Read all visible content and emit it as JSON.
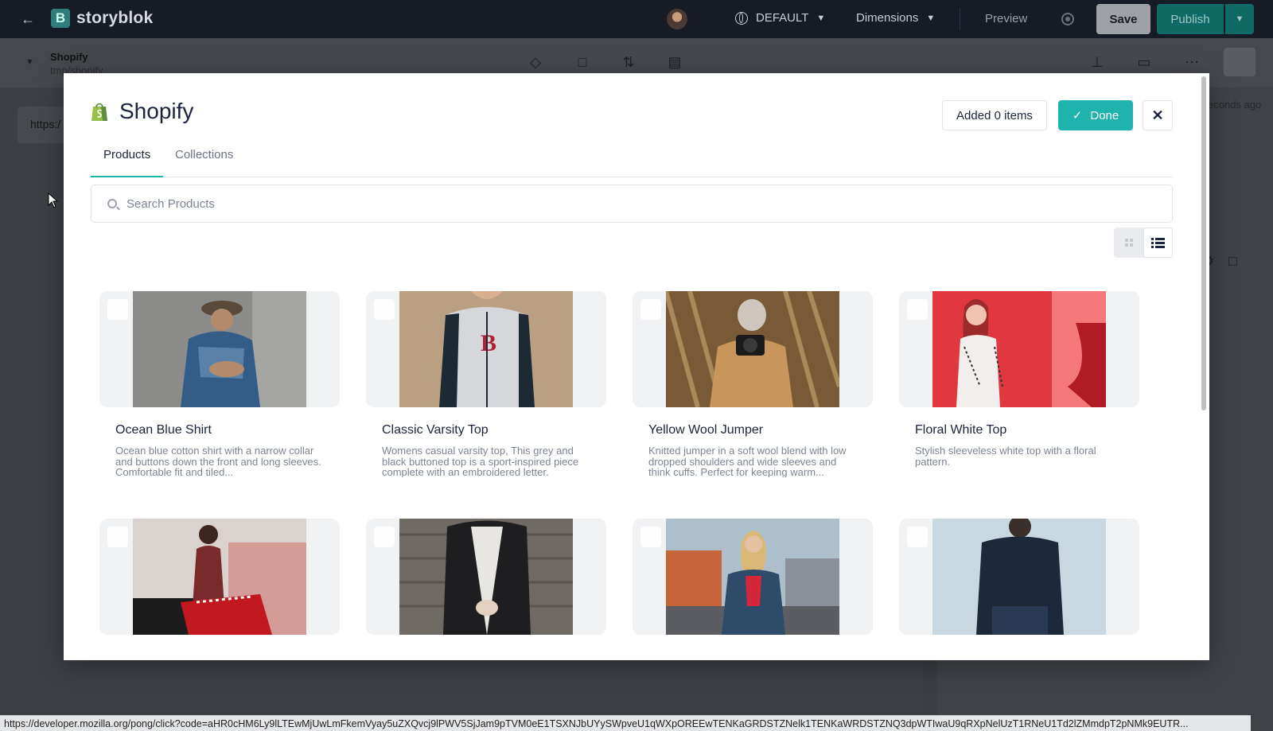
{
  "topbar": {
    "logo_text": "storyblok",
    "language": "DEFAULT",
    "dimensions": "Dimensions",
    "preview": "Preview",
    "save": "Save",
    "publish": "Publish"
  },
  "subbar": {
    "story_title": "Shopify",
    "story_path": "tmp/shopify"
  },
  "background": {
    "url_field": "https:/",
    "saved_time": "econds ago"
  },
  "modal": {
    "title": "Shopify",
    "added_label": "Added 0 items",
    "done_label": "Done",
    "tabs": [
      {
        "label": "Products",
        "active": true
      },
      {
        "label": "Collections",
        "active": false
      }
    ],
    "search_placeholder": "Search Products",
    "view_mode": "list"
  },
  "products": [
    {
      "title": "Ocean Blue Shirt",
      "description": "Ocean blue cotton shirt with a narrow collar and buttons down the front and long sleeves. Comfortable fit and tiled..."
    },
    {
      "title": "Classic Varsity Top",
      "description": "Womens casual varsity top, This grey and black buttoned top is a sport-inspired piece complete with an embroidered letter."
    },
    {
      "title": "Yellow Wool Jumper",
      "description": "Knitted jumper in a soft wool blend with low dropped shoulders and wide sleeves and think cuffs. Perfect for keeping warm..."
    },
    {
      "title": "Floral White Top",
      "description": "Stylish sleeveless white top with a floral pattern."
    },
    {
      "title": "",
      "description": ""
    },
    {
      "title": "",
      "description": ""
    },
    {
      "title": "",
      "description": ""
    },
    {
      "title": "",
      "description": ""
    }
  ],
  "status_url": "https://developer.mozilla.org/pong/click?code=aHR0cHM6Ly9lLTEwMjUwLmFkemVyay5uZXQvcj9lPWV5SjJam9pTVM0eE1TSXNJbUYySWpveU1qWXpOREEwTENKaGRDSTZNelk1TENKaWRDSTZNQ3dpWTIwaU9qRXpNelUzT1RNeU1Td2lZMmdpT2pNMk9EUTR..."
}
